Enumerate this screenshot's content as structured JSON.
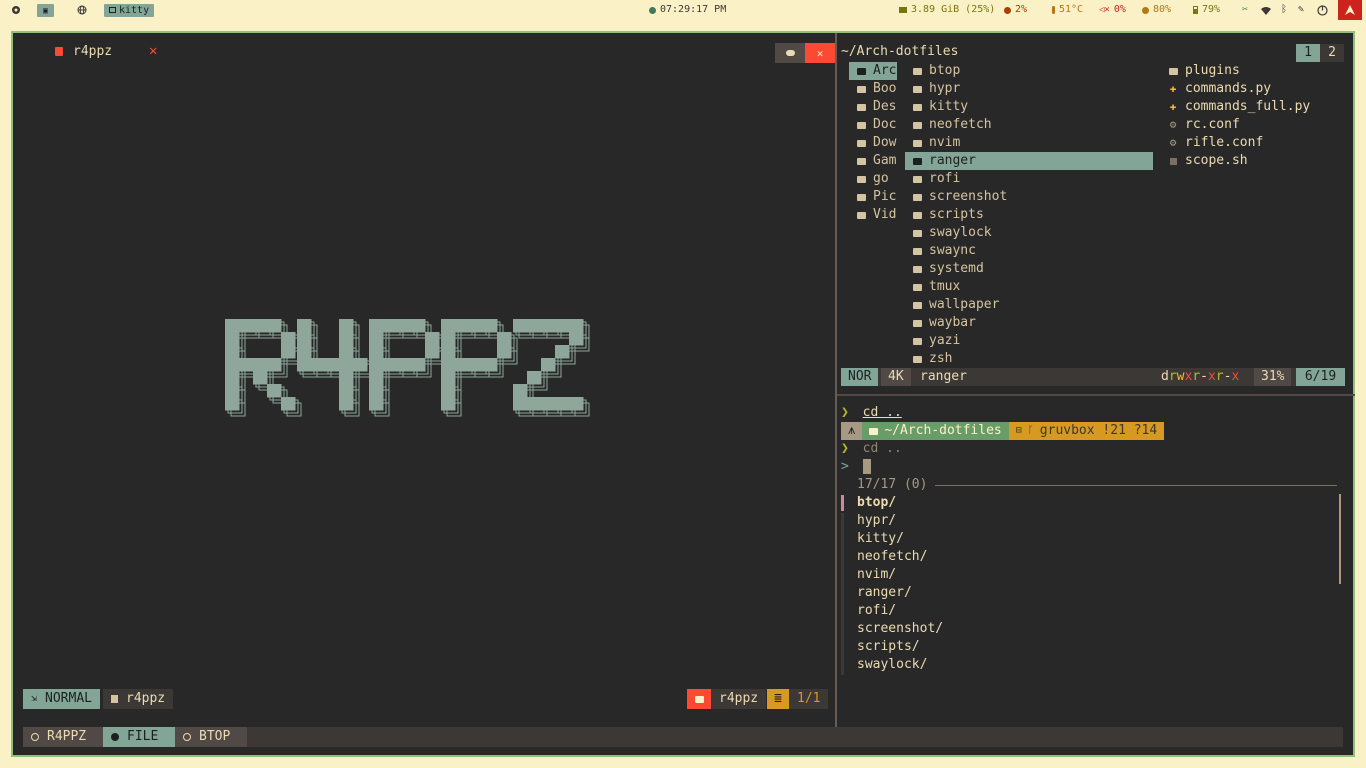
{
  "topbar": {
    "workspace_label": "▣",
    "app_label": "kitty",
    "clock": "07:29:17 PM",
    "memory": "3.89 GiB (25%)",
    "cpu": "2%",
    "temperature": "51°C",
    "volume": "0%",
    "brightness": "80%",
    "battery": "79%"
  },
  "nvim": {
    "tab_title": "r4ppz",
    "art_text": "R4PPZ",
    "mode": "NORMAL",
    "file_name": "r4ppz",
    "right_file": "r4ppz",
    "position": "1/1"
  },
  "tmux": {
    "tabs": [
      {
        "label": "R4PPZ",
        "active": false
      },
      {
        "label": "FILE",
        "active": true
      },
      {
        "label": "BTOP",
        "active": false
      }
    ]
  },
  "ranger": {
    "path": "~/Arch-dotfiles",
    "tabs": [
      "1",
      "2"
    ],
    "parent_items": [
      {
        "label": "Arc",
        "icon": "folder-icon"
      },
      {
        "label": "Boo",
        "icon": "folder-icon"
      },
      {
        "label": "Des",
        "icon": "desktop-icon"
      },
      {
        "label": "Doc",
        "icon": "document-icon"
      },
      {
        "label": "Dow",
        "icon": "download-icon"
      },
      {
        "label": "Gam",
        "icon": "folder-icon"
      },
      {
        "label": "go",
        "icon": "folder-icon"
      },
      {
        "label": "Pic",
        "icon": "picture-icon"
      },
      {
        "label": "Vid",
        "icon": "video-icon"
      }
    ],
    "current_items": [
      "btop",
      "hypr",
      "kitty",
      "neofetch",
      "nvim",
      "ranger",
      "rofi",
      "screenshot",
      "scripts",
      "swaylock",
      "swaync",
      "systemd",
      "tmux",
      "wallpaper",
      "waybar",
      "yazi",
      "zsh"
    ],
    "selected_item": "ranger",
    "preview_items": [
      {
        "label": "plugins",
        "icon": "folder-icon"
      },
      {
        "label": "commands.py",
        "icon": "python-icon"
      },
      {
        "label": "commands_full.py",
        "icon": "python-icon"
      },
      {
        "label": "rc.conf",
        "icon": "gear-icon"
      },
      {
        "label": "rifle.conf",
        "icon": "gear-icon"
      },
      {
        "label": "scope.sh",
        "icon": "script-icon"
      }
    ],
    "status": {
      "mode": "NOR",
      "size": "4K",
      "name": "ranger",
      "percent": "31%",
      "count": "6/19"
    },
    "permissions": [
      {
        "ch": "d",
        "color": "#ebdbb2"
      },
      {
        "ch": "r",
        "color": "#b8bb26"
      },
      {
        "ch": "w",
        "color": "#fabd2f"
      },
      {
        "ch": "x",
        "color": "#fb4934"
      },
      {
        "ch": "r",
        "color": "#b8bb26"
      },
      {
        "ch": "-",
        "color": "#ebdbb2"
      },
      {
        "ch": "x",
        "color": "#fb4934"
      },
      {
        "ch": "r",
        "color": "#b8bb26"
      },
      {
        "ch": "-",
        "color": "#ebdbb2"
      },
      {
        "ch": "x",
        "color": "#fb4934"
      }
    ]
  },
  "shell": {
    "cmd1_prompt": "❯",
    "cmd1_text": "cd ..",
    "prompt_user": "⩚",
    "prompt_path": "~/Arch-dotfiles",
    "prompt_git": "gruvbox !21 ?14",
    "cmd2_prompt": "❯",
    "cmd2_text": "cd ..",
    "fzf_prompt": ">",
    "fzf_count": "17/17 (0)",
    "fzf_items": [
      "btop/",
      "hypr/",
      "kitty/",
      "neofetch/",
      "nvim/",
      "ranger/",
      "rofi/",
      "screenshot/",
      "scripts/",
      "swaylock/"
    ]
  },
  "colors": {
    "accent": "#83a598",
    "border": "#8ec07c",
    "bg": "#282828",
    "red": "#fb4934",
    "yellow": "#d79921"
  }
}
